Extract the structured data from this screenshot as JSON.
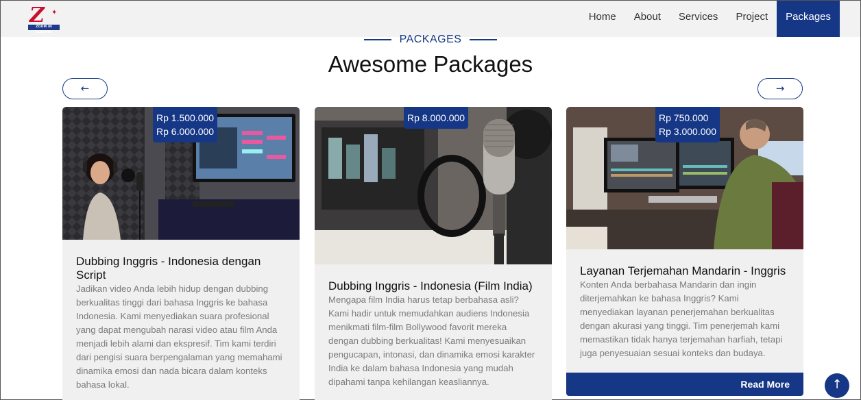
{
  "brand": {
    "logo_text": "ZOOM IN JAKARTA"
  },
  "nav": {
    "items": [
      "Home",
      "About",
      "Services",
      "Project",
      "Packages"
    ],
    "active": "Packages"
  },
  "section": {
    "tag": "PACKAGES",
    "title": "Awesome Packages"
  },
  "carousel": {
    "prev_label": "←",
    "next_label": "→"
  },
  "cards": [
    {
      "prices": [
        "Rp 1.500.000",
        "Rp 6.000.000"
      ],
      "title": "Dubbing Inggris - Indonesia dengan Script",
      "description": "Jadikan video Anda lebih hidup dengan dubbing berkualitas tinggi dari bahasa Inggris ke bahasa Indonesia. Kami menyediakan suara profesional yang dapat mengubah narasi video atau film Anda menjadi lebih alami dan ekspresif. Tim kami terdiri dari pengisi suara berpengalaman yang memahami dinamika emosi dan nada bicara dalam konteks bahasa lokal."
    },
    {
      "prices": [
        "Rp 8.000.000"
      ],
      "title": "Dubbing Inggris - Indonesia (Film India)",
      "description": "Mengapa film India harus tetap berbahasa asli? Kami hadir untuk memudahkan audiens Indonesia menikmati film-film Bollywood favorit mereka dengan dubbing berkualitas! Kami menyesuaikan pengucapan, intonasi, dan dinamika emosi karakter India ke dalam bahasa Indonesia yang mudah dipahami tanpa kehilangan keasliannya."
    },
    {
      "prices": [
        "Rp 750.000",
        "Rp 3.000.000"
      ],
      "title": "Layanan Terjemahan Mandarin - Inggris",
      "description": "Konten Anda berbahasa Mandarin dan ingin diterjemahkan ke bahasa Inggris? Kami menyediakan layanan penerjemahan berkualitas dengan akurasi yang tinggi. Tim penerjemah kami memastikan tidak hanya terjemahan harfiah, tetapi juga penyesuaian sesuai konteks dan budaya.",
      "button": "Read More"
    }
  ],
  "scroll_top": {
    "label": "↑"
  },
  "colors": {
    "primary": "#163786",
    "nav_bg": "#f2f2f2",
    "card_bg": "#f0f0f0"
  }
}
